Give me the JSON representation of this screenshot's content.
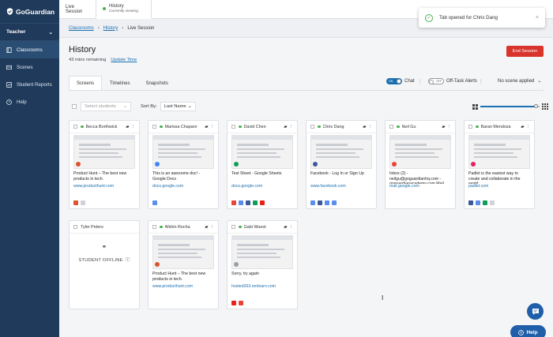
{
  "app": {
    "logo_text": "GoGuardian"
  },
  "sidebar": {
    "role_label": "Teacher",
    "items": [
      {
        "label": "Classrooms",
        "icon": "book-icon"
      },
      {
        "label": "Scenes",
        "icon": "scenes-icon"
      },
      {
        "label": "Student Reports",
        "icon": "reports-icon"
      },
      {
        "label": "Help",
        "icon": "help-icon"
      }
    ]
  },
  "top_tabs": [
    {
      "label": "Live Session"
    },
    {
      "label": "History",
      "sub": "Currently viewing"
    }
  ],
  "breadcrumb": [
    "Classrooms",
    "History",
    "Live Session"
  ],
  "toast": {
    "message": "Tab opened for Chris Dang",
    "close": "×"
  },
  "header": {
    "title": "History",
    "remaining": "43 mins remaining",
    "update_link": "Update Time",
    "end_button": "End Session"
  },
  "view_tabs": [
    "Screens",
    "Timelines",
    "Snapshots"
  ],
  "toggles": {
    "chat": {
      "state": "ON",
      "label": "Chat"
    },
    "offtask": {
      "state": "OFF",
      "label": "Off-Task Alerts"
    }
  },
  "scene_select": "No scene applied",
  "controls": {
    "select_placeholder": "Select students",
    "sort_label": "Sort By:",
    "sort_value": "Last Name"
  },
  "zoom_level": 0.95,
  "students": [
    {
      "name": "Becca Borthwick",
      "online": true,
      "title": "Product Hunt – The best new products in tech.",
      "url": "www.producthunt.com",
      "site_color": "#da552f",
      "icons": [
        "#da552f",
        "#cfd3d8"
      ]
    },
    {
      "name": "Marissa Chaparo",
      "online": true,
      "title": "This is an awesome doc! - Google Docs",
      "url": "docs.google.com",
      "site_color": "#4285f4",
      "icons": [
        "#5b8def"
      ]
    },
    {
      "name": "David Chen",
      "online": true,
      "title": "Test Sheet - Google Sheets",
      "url": "docs.google.com",
      "site_color": "#0f9d58",
      "icons": [
        "#ea4335",
        "#5b8def",
        "#3b5998",
        "#0f9d58",
        "#e62117"
      ]
    },
    {
      "name": "Chris Dang",
      "online": true,
      "title": "Facebook - Log In or Sign Up",
      "url": "www.facebook.com",
      "site_color": "#3b5998",
      "icons": [
        "#5b8def",
        "#3b5998",
        "#5b8def",
        "#5b8def"
      ]
    },
    {
      "name": "Neil Gu",
      "online": true,
      "title": "Inbox (2) - neilgu@goguardianhq.com - goguardianacademy.com Mail",
      "url": "mail.google.com",
      "site_color": "#ea4335",
      "icons": []
    },
    {
      "name": "Baran Mendoza",
      "online": true,
      "title": "Padlet is the easiest way to create and collaborate in the world",
      "url": "padlet.com",
      "site_color": "#e91e63",
      "icons": [
        "#3b5998",
        "#5b8def",
        "#0f9d58",
        "#cfd3d8"
      ]
    },
    {
      "name": "Tyler Peters",
      "online": false,
      "offline_text": "STUDENT OFFLINE",
      "title": "",
      "url": "",
      "site_color": "",
      "icons": []
    },
    {
      "name": "Afshin Rocha",
      "online": true,
      "title": "Product Hunt – The best new products in tech.",
      "url": "www.producthunt.com",
      "site_color": "#da552f",
      "icons": []
    },
    {
      "name": "Gabi Wuest",
      "online": true,
      "title": "Sorry, try again",
      "url": "hosted263.renlearn.com",
      "site_color": "#9aa0a6",
      "icons": [
        "#e62117",
        "#ea4335"
      ]
    }
  ],
  "fab": {
    "help_label": "Help"
  }
}
